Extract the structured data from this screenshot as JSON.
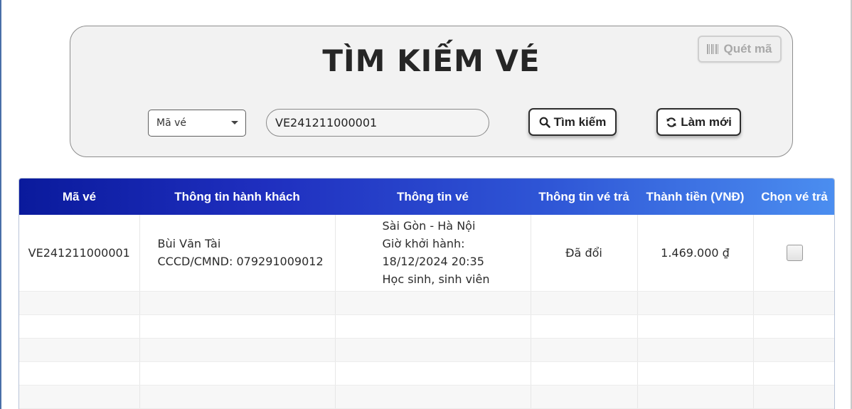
{
  "search": {
    "title": "TÌM KIẾM VÉ",
    "scan_label": "Quét mã",
    "filter_selected": "Mã vé",
    "input_value": "VE241211000001",
    "search_label": "Tìm kiếm",
    "refresh_label": "Làm mới"
  },
  "table": {
    "headers": [
      "Mã vé",
      "Thông tin hành khách",
      "Thông tin vé",
      "Thông tin vé trả",
      "Thành tiền (VNĐ)",
      "Chọn vé trả"
    ],
    "rows": [
      {
        "ticket_code": "VE241211000001",
        "passenger_name": "Bùi Văn Tài",
        "passenger_id": "CCCD/CMND: 079291009012",
        "route": "Sài Gòn - Hà Nội",
        "departure_label": "Giờ khởi hành:",
        "departure_time": "18/12/2024 20:35",
        "passenger_type": "Học sinh, sinh viên",
        "return_status": "Đã đổi",
        "amount": "1.469.000 ₫",
        "selected": false
      }
    ]
  },
  "icons": {
    "scan": "barcode-icon",
    "search": "search-icon",
    "refresh": "refresh-icon",
    "dropdown": "chevron-down-icon"
  },
  "colors": {
    "header_gradient_start": "#0a1a9c",
    "header_gradient_end": "#4b8ef0",
    "panel_bg": "#f2f2f2"
  }
}
